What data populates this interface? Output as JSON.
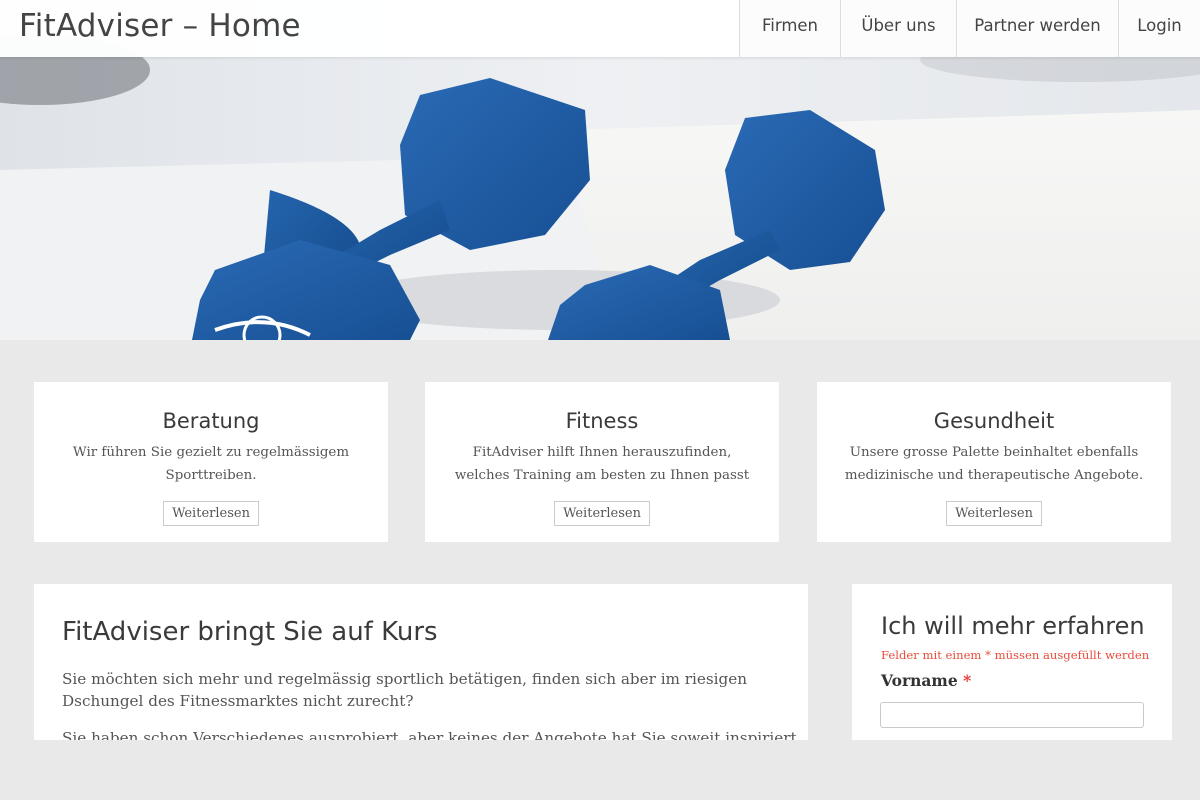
{
  "header": {
    "brand": "FitAdviser – Home",
    "nav": [
      "Firmen",
      "Über uns",
      "Partner werden",
      "Login"
    ]
  },
  "hero": {
    "image": "blue dumbbells"
  },
  "cards": [
    {
      "title": "Beratung",
      "text": "Wir führen Sie gezielt zu regelmässigem Sporttreiben.",
      "button": "Weiterlesen"
    },
    {
      "title": "Fitness",
      "text": "FitAdviser hilft Ihnen herauszufinden, welches Training am besten zu Ihnen passt",
      "button": "Weiterlesen"
    },
    {
      "title": "Gesundheit",
      "text": "Unsere grosse Palette beinhaltet ebenfalls medizinische und therapeutische Angebote.",
      "button": "Weiterlesen"
    }
  ],
  "article": {
    "title": "FitAdviser bringt Sie auf Kurs",
    "paragraphs": [
      "Sie möchten sich mehr und regelmässig sportlich betätigen, finden sich aber im riesigen Dschungel des Fitnessmarktes nicht zurecht?",
      "Sie haben schon Verschiedenes ausprobiert, aber keines der Angebote hat Sie soweit inspiriert"
    ]
  },
  "form": {
    "title": "Ich will mehr erfahren",
    "required_note": "Felder mit einem * müssen ausgefüllt werden",
    "field_label": "Vorname",
    "required_mark": "*",
    "field_value": ""
  },
  "colors": {
    "dumbbell": "#1f5fa8",
    "background": "#e9e9e9",
    "required": "#e53935"
  }
}
